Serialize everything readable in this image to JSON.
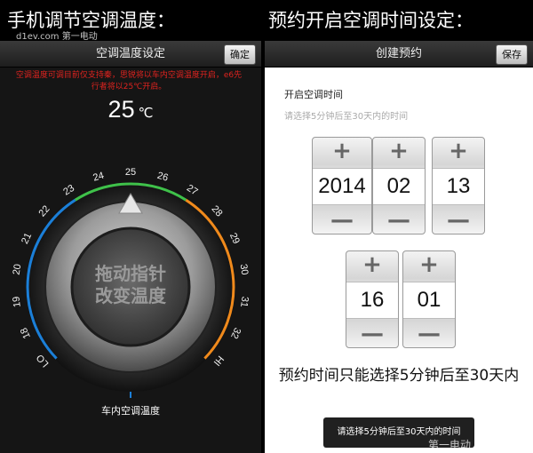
{
  "captions": {
    "left": "手机调节空调温度：",
    "right": "预约开启空调时间设定："
  },
  "left_screen": {
    "title": "空调温度设定",
    "confirm_label": "确定",
    "notice_line1": "空调温度可调目前仅支持秦，思锐将以车内空调温度开启，e6先",
    "notice_line2": "行者将以25℃开启。",
    "temperature": "25",
    "temperature_unit": "℃",
    "dial_labels": [
      "LO",
      "18",
      "19",
      "20",
      "21",
      "22",
      "23",
      "24",
      "25",
      "26",
      "27",
      "28",
      "29",
      "30",
      "31",
      "32",
      "HI"
    ],
    "dial_value": 25,
    "knob_text_line1": "拖动指针",
    "knob_text_line2": "改变温度",
    "current_temp_label": "车内空调温度",
    "colors": {
      "cold_arc": "#1b7fd8",
      "mid_arc": "#3fc14a",
      "warm_arc": "#f08a1c",
      "notice": "#e0231f"
    }
  },
  "right_screen": {
    "title": "创建预约",
    "save_label": "保存",
    "section_label": "开启空调时间",
    "hint": "请选择5分钟后至30天内的时间",
    "pickers": {
      "year": "2014",
      "month": "02",
      "day": "13",
      "hour": "16",
      "minute": "01"
    },
    "plus_symbol": "+",
    "minus_symbol": "—",
    "rule_text": "预约时间只能选择5分钟后至30天内",
    "toast": "请选择5分钟后至30天内的时间"
  },
  "watermarks": {
    "top": "d1ev.com 第一电动",
    "bottom": "第一电动"
  }
}
